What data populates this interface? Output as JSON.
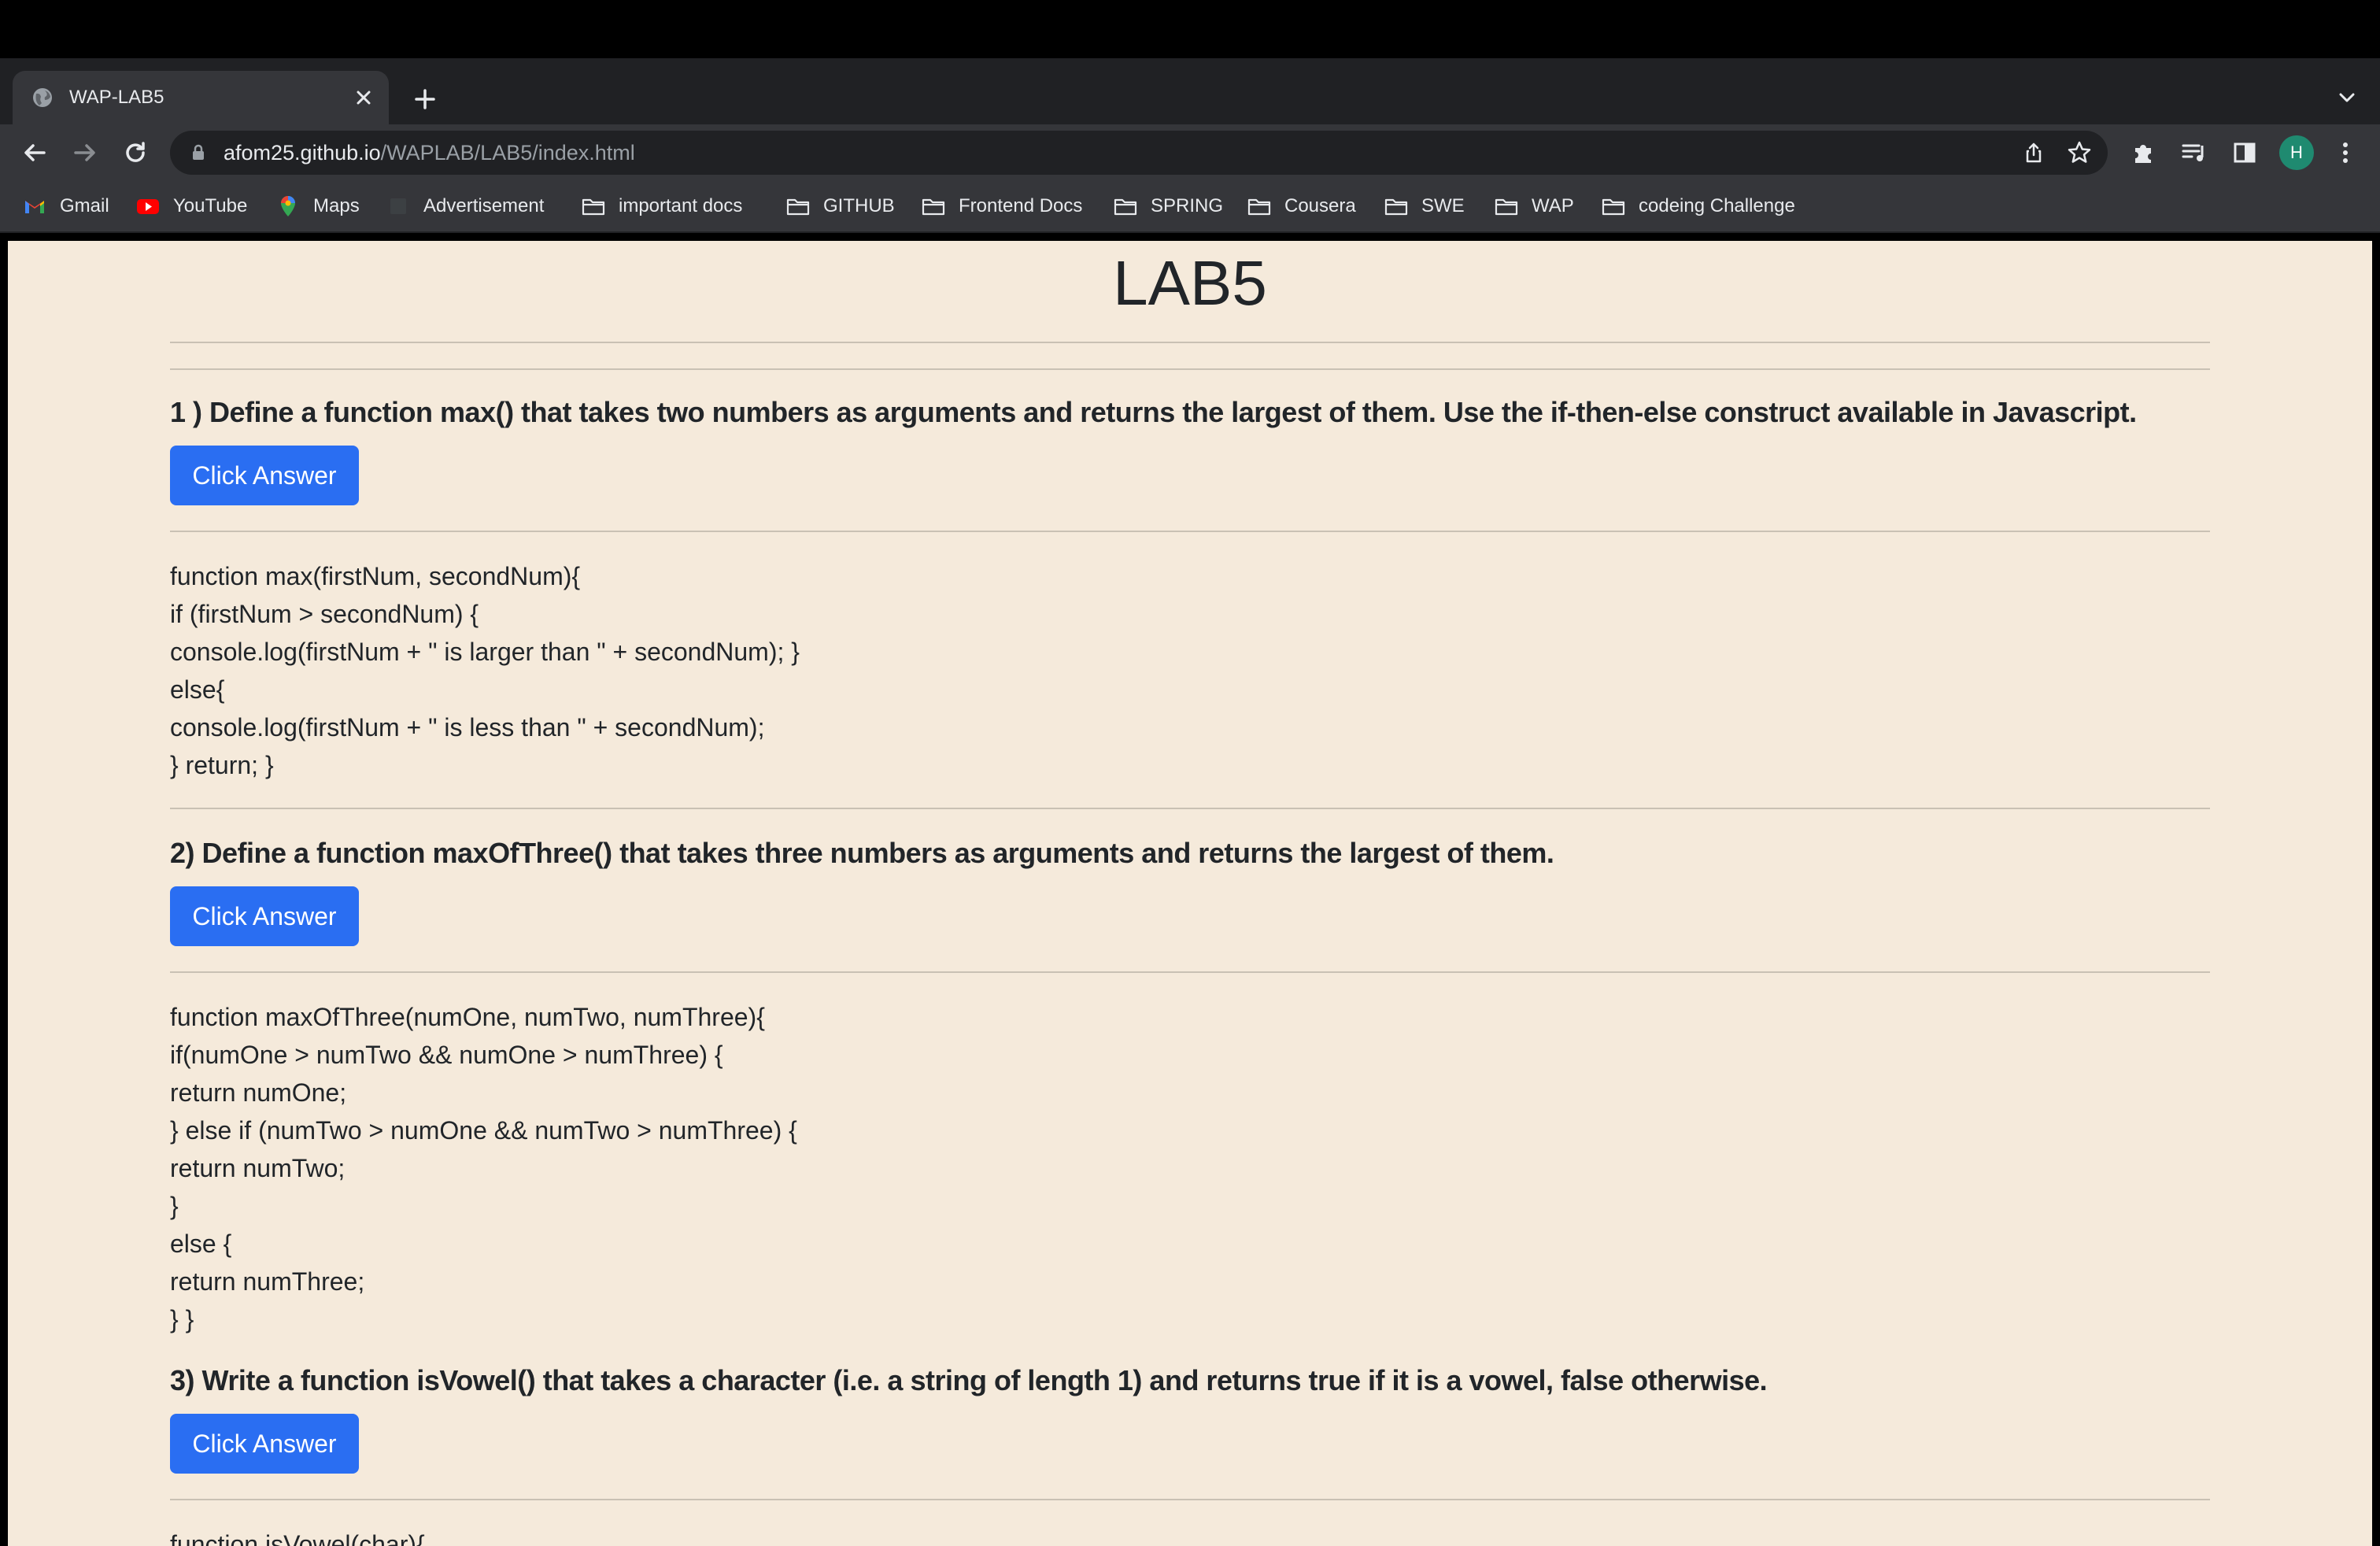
{
  "browser": {
    "tab": {
      "title": "WAP-LAB5"
    },
    "address_bar": {
      "host": "afom25.github.io",
      "path": "/WAPLAB/LAB5/index.html"
    },
    "profile_initial": "H",
    "bookmarks": [
      {
        "label": "Gmail",
        "icon": "gmail-icon"
      },
      {
        "label": "YouTube",
        "icon": "youtube-icon"
      },
      {
        "label": "Maps",
        "icon": "maps-icon"
      },
      {
        "label": "Advertisement",
        "icon": "page-icon"
      },
      {
        "label": "important docs",
        "icon": "folder-icon"
      },
      {
        "label": "GITHUB",
        "icon": "folder-icon"
      },
      {
        "label": "Frontend Docs",
        "icon": "folder-icon"
      },
      {
        "label": "SPRING",
        "icon": "folder-icon"
      },
      {
        "label": "Cousera",
        "icon": "folder-icon"
      },
      {
        "label": "SWE",
        "icon": "folder-icon"
      },
      {
        "label": "WAP",
        "icon": "folder-icon"
      },
      {
        "label": "codeing Challenge",
        "icon": "folder-icon"
      }
    ]
  },
  "page": {
    "title": "LAB5",
    "questions": [
      {
        "text": "1 ) Define a function max() that takes two numbers as arguments and returns the largest of them. Use the if-then-else construct available in Javascript.",
        "button_label": "Click Answer",
        "code_lines": [
          "function max(firstNum, secondNum){",
          "if (firstNum > secondNum) {",
          "console.log(firstNum + \" is larger than \" + secondNum); }",
          "else{",
          "console.log(firstNum + \" is less than \" + secondNum);",
          "} return; }"
        ]
      },
      {
        "text": "2) Define a function maxOfThree() that takes three numbers as arguments and returns the largest of them.",
        "button_label": "Click Answer",
        "code_lines": [
          "function maxOfThree(numOne, numTwo, numThree){",
          "if(numOne > numTwo && numOne > numThree) {",
          "return numOne;",
          "} else if (numTwo > numOne && numTwo > numThree) {",
          "return numTwo;",
          "}",
          "else {",
          "return numThree;",
          "} }"
        ]
      },
      {
        "text": "3) Write a function isVowel() that takes a character (i.e. a string of length 1) and returns true if it is a vowel, false otherwise.",
        "button_label": "Click Answer",
        "code_lines": [
          "function isVowel(char){"
        ]
      }
    ]
  },
  "colors": {
    "page_background": "#f5eadb",
    "button_blue": "#2a6ef2",
    "text_dark": "#212529"
  }
}
